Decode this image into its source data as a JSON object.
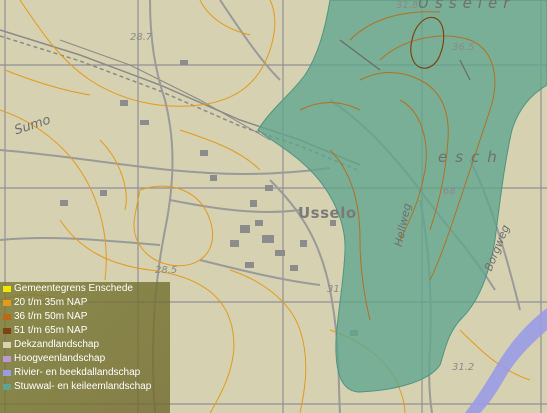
{
  "map": {
    "place_labels": {
      "usselo": "Usselo",
      "esch": "esch",
      "usseler": "Usseler",
      "sumo": "Sumo"
    },
    "street_labels": {
      "hellweg": "Hellweg",
      "borgweg": "Borgweg"
    },
    "contour_labels": {
      "c1": "28.7",
      "c2": "31.8",
      "c3": "36.5",
      "c4": "68",
      "c5": "28.5",
      "c6": "31.",
      "c7": "31.2"
    }
  },
  "legend": {
    "items": [
      {
        "label": "Gemeentegrens Enschede",
        "color": "#f2e600"
      },
      {
        "label": "20 t/m 35m NAP",
        "color": "#e39a1e"
      },
      {
        "label": "36 t/m 50m NAP",
        "color": "#b86b16"
      },
      {
        "label": "51 t/m 65m NAP",
        "color": "#7a4512"
      },
      {
        "label": "Dekzandlandschap",
        "color": "#d9d2b0"
      },
      {
        "label": "Hoogveenlandschap",
        "color": "#b89ad0"
      },
      {
        "label": "Rivier- en beekdallandschap",
        "color": "#9a9be6"
      },
      {
        "label": "Stuwwal- en keileemlandschap",
        "color": "#5fa58e"
      }
    ]
  }
}
